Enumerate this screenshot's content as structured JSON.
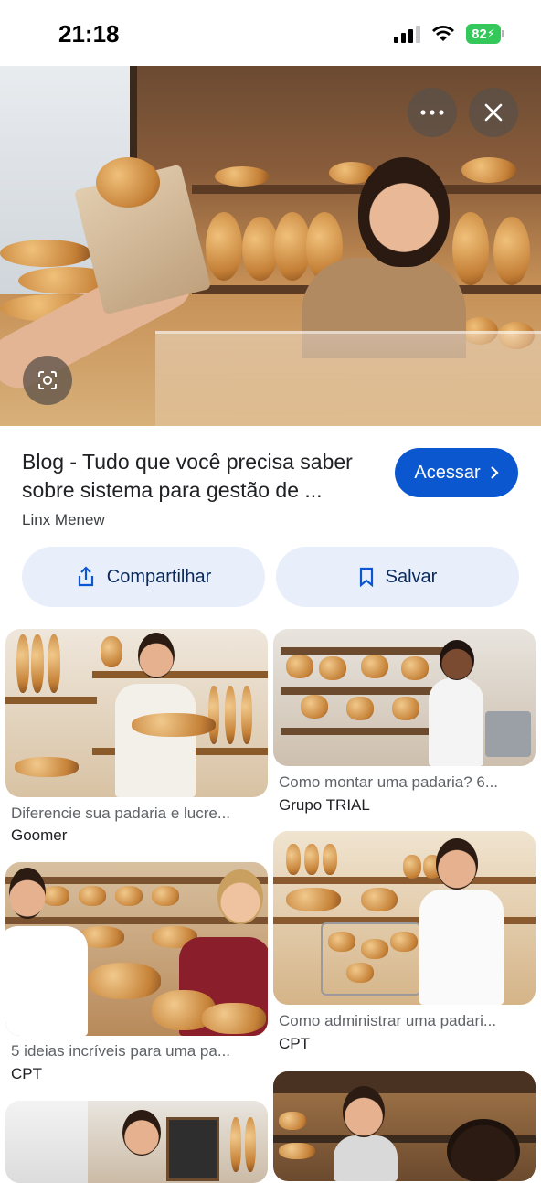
{
  "status_bar": {
    "time": "21:18",
    "battery": "82"
  },
  "result": {
    "title": "Blog - Tudo que você precisa saber sobre sistema para gestão de ...",
    "source": "Linx Menew",
    "visit_label": "Acessar"
  },
  "actions": {
    "share_label": "Compartilhar",
    "save_label": "Salvar"
  },
  "related": [
    {
      "caption": "Diferencie sua padaria e lucre...",
      "source": "Goomer"
    },
    {
      "caption": "Como montar uma padaria? 6...",
      "source": "Grupo TRIAL"
    },
    {
      "caption": "5 ideias incríveis para uma pa...",
      "source": "CPT"
    },
    {
      "caption": "Como administrar uma padari...",
      "source": "CPT"
    }
  ],
  "colors": {
    "accent": "#0b57d0",
    "action_bg": "#e8effb",
    "battery": "#34c759"
  },
  "icons": {
    "more": "more-icon",
    "close": "close-icon",
    "lens": "lens-icon",
    "share": "share-icon",
    "bookmark": "bookmark-icon"
  }
}
